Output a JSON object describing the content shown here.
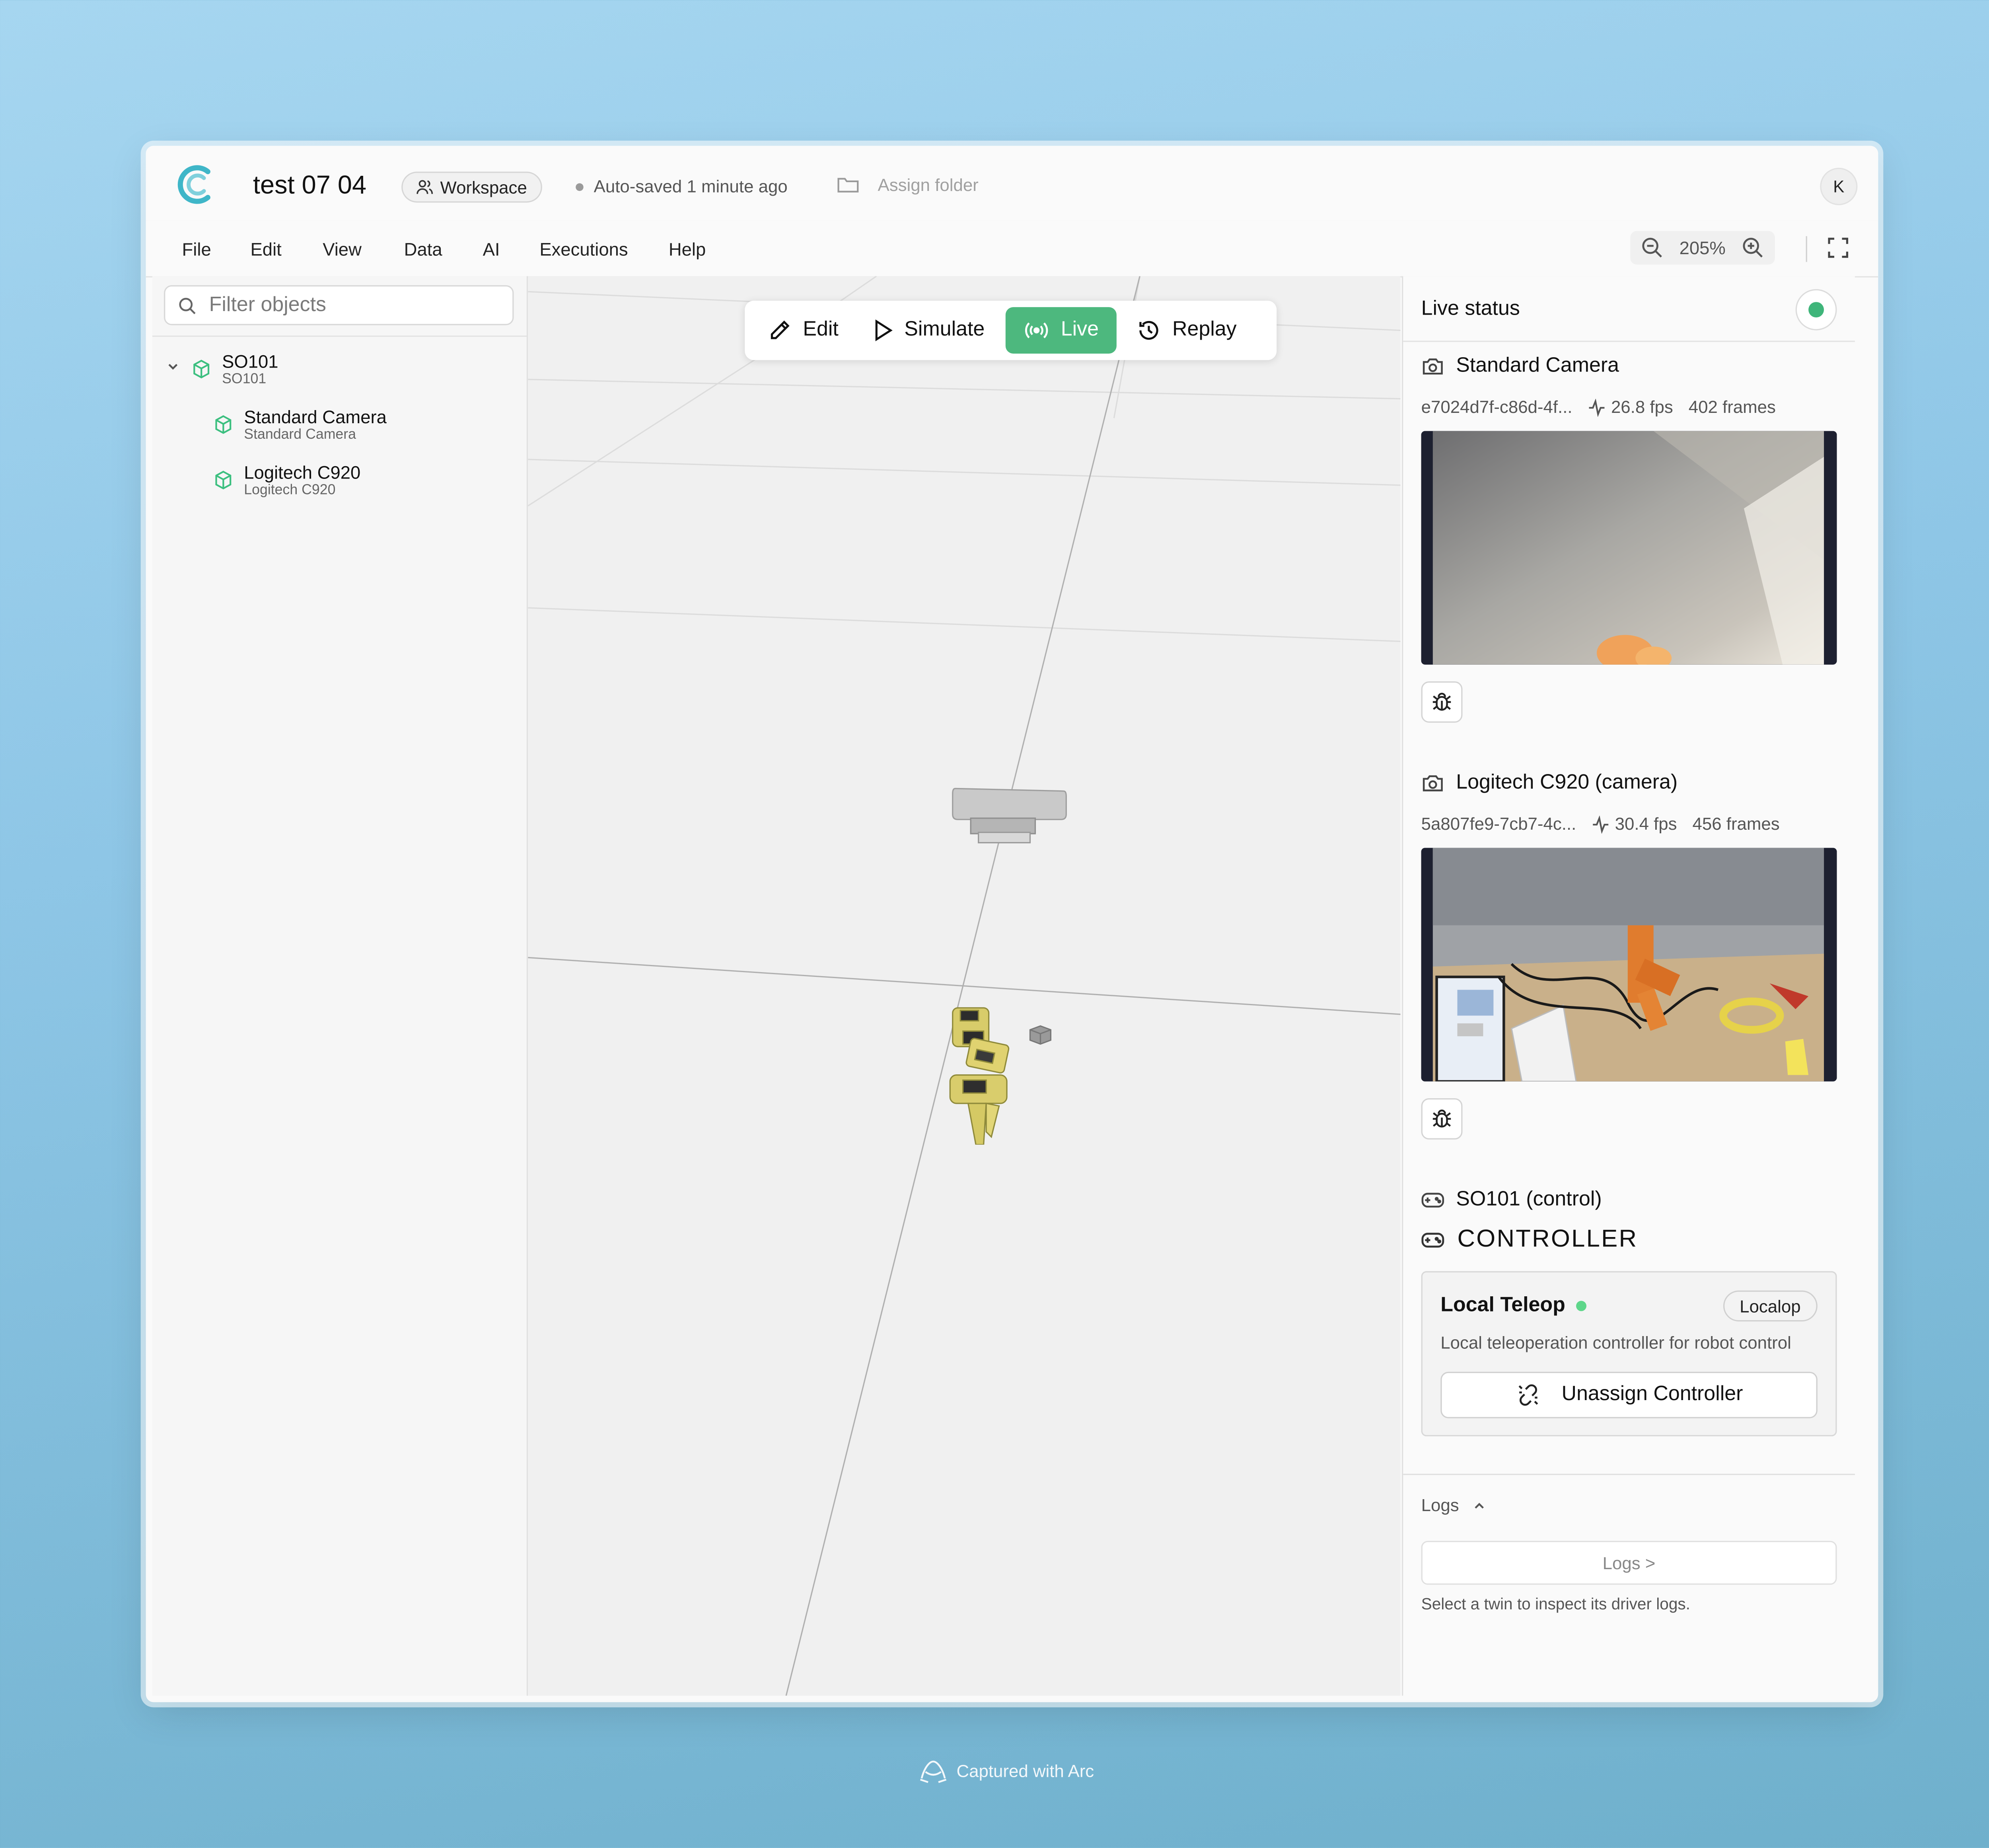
{
  "header": {
    "project_title": "test 07 04",
    "workspace_label": "Workspace",
    "autosave_text": "Auto-saved 1 minute ago",
    "assign_folder_label": "Assign folder",
    "avatar_initial": "K"
  },
  "menu": [
    "File",
    "Edit",
    "View",
    "Data",
    "AI",
    "Executions",
    "Help"
  ],
  "zoom": {
    "level": "205%"
  },
  "left_panel": {
    "filter_placeholder": "Filter objects",
    "tree": [
      {
        "name": "SO101",
        "subtitle": "SO101"
      },
      {
        "name": "Standard Camera",
        "subtitle": "Standard Camera"
      },
      {
        "name": "Logitech C920",
        "subtitle": "Logitech C920"
      }
    ]
  },
  "modes": {
    "edit": "Edit",
    "simulate": "Simulate",
    "live": "Live",
    "replay": "Replay",
    "active": "Live"
  },
  "right_panel": {
    "title": "Live status",
    "status_color": "#3fb57a",
    "cameras": [
      {
        "title": "Standard Camera",
        "id": "e7024d7f-c86d-4f...",
        "fps": "26.8 fps",
        "frames": "402 frames"
      },
      {
        "title": "Logitech C920 (camera)",
        "id": "5a807fe9-7cb7-4c...",
        "fps": "30.4 fps",
        "frames": "456 frames"
      }
    ],
    "control": {
      "title": "SO101 (control)",
      "section_label": "CONTROLLER",
      "card_title": "Local Teleop",
      "badge": "Localop",
      "description": "Local teleoperation controller for robot control",
      "unassign_label": "Unassign Controller"
    },
    "logs": {
      "header": "Logs",
      "button": "Logs >",
      "note": "Select a twin to inspect its driver logs."
    }
  },
  "footer": {
    "capture_text": "Captured with Arc"
  },
  "colors": {
    "accent_green": "#4db87e",
    "logo_teal": "#3fb6c8"
  }
}
